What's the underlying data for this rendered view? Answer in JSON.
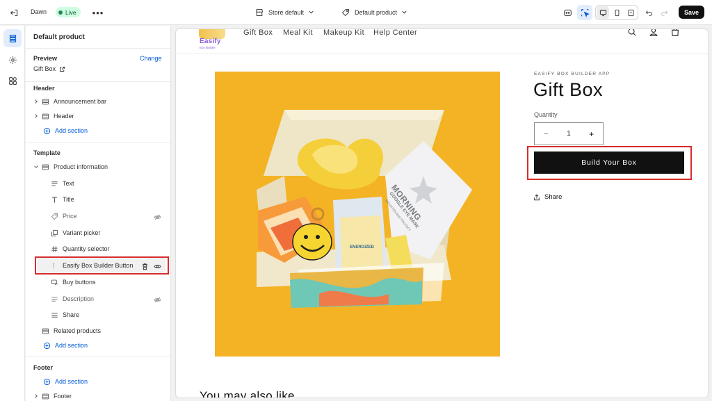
{
  "topbar": {
    "theme_name": "Dawn",
    "live_badge": "Live",
    "store_label": "Store default",
    "product_label": "Default product",
    "save_label": "Save"
  },
  "sidebar": {
    "title": "Default product",
    "preview_label": "Preview",
    "change_label": "Change",
    "preview_value": "Gift Box",
    "header_group": "Header",
    "announcement_bar": "Announcement bar",
    "header_item": "Header",
    "add_section_1": "Add section",
    "template_group": "Template",
    "product_information": "Product information",
    "blocks": [
      {
        "label": "Text",
        "icon": "text-lines-icon"
      },
      {
        "label": "Title",
        "icon": "title-t-icon"
      },
      {
        "label": "Price",
        "icon": "price-tag-icon"
      },
      {
        "label": "Variant picker",
        "icon": "variant-icon"
      },
      {
        "label": "Quantity selector",
        "icon": "hash-icon"
      },
      {
        "label": "Easify Box Builder Button",
        "icon": "drag-handle-icon"
      },
      {
        "label": "Buy buttons",
        "icon": "cart-icon"
      },
      {
        "label": "Description",
        "icon": "text-lines-icon"
      },
      {
        "label": "Share",
        "icon": "share-icon"
      }
    ],
    "related_products": "Related products",
    "add_section_2": "Add section",
    "footer_group": "Footer",
    "add_section_3": "Add section",
    "footer_item": "Footer"
  },
  "store": {
    "logo_text": "Easify",
    "logo_sub": "Box Builder",
    "nav": [
      "Gift Box",
      "Meal Kit",
      "Makeup Kit",
      "Help Center"
    ],
    "vendor": "EASIFY BOX BUILDER APP",
    "product_title": "Gift Box",
    "quantity_label": "Quantity",
    "quantity_value": "1",
    "qty_minus": "−",
    "qty_plus": "+",
    "build_button": "Build Your Box",
    "share_label": "Share",
    "also_like": "You may also like",
    "image_texts": {
      "mask_title": "MORNING",
      "mask_sub": "GOOGLE EYE MASK",
      "mask_tag": "BRIGHTEN AND PROTECT",
      "pouch_label": "ENERGIZED"
    }
  },
  "colors": {
    "accent_blue": "#005bd3",
    "live_green": "#29845a",
    "highlight_red": "#d82c2c",
    "product_bg": "#f4b324"
  }
}
